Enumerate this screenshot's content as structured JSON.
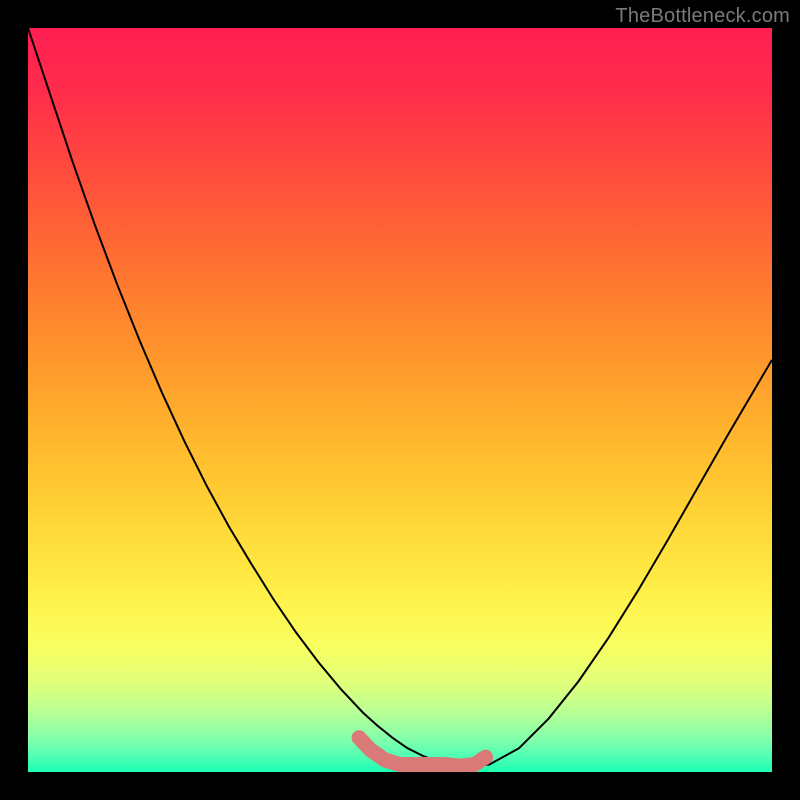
{
  "watermark": "TheBottleneck.com",
  "chart_data": {
    "type": "line",
    "title": "",
    "xlabel": "",
    "ylabel": "",
    "xlim": [
      0,
      1
    ],
    "ylim": [
      0,
      1
    ],
    "grid": false,
    "background_gradient_stops": [
      {
        "pos": 0.0,
        "color": "#ff1f52"
      },
      {
        "pos": 0.085,
        "color": "#ff2c4b"
      },
      {
        "pos": 0.17,
        "color": "#ff4540"
      },
      {
        "pos": 0.255,
        "color": "#ff5e37"
      },
      {
        "pos": 0.34,
        "color": "#ff7830"
      },
      {
        "pos": 0.425,
        "color": "#ff912c"
      },
      {
        "pos": 0.51,
        "color": "#ffaa2c"
      },
      {
        "pos": 0.595,
        "color": "#ffc330"
      },
      {
        "pos": 0.68,
        "color": "#ffdb3a"
      },
      {
        "pos": 0.765,
        "color": "#fff14a"
      },
      {
        "pos": 0.83,
        "color": "#f9ff60"
      },
      {
        "pos": 0.88,
        "color": "#e0ff7a"
      },
      {
        "pos": 0.92,
        "color": "#b8ff94"
      },
      {
        "pos": 0.955,
        "color": "#84ffaa"
      },
      {
        "pos": 0.98,
        "color": "#4effb4"
      },
      {
        "pos": 1.0,
        "color": "#1cffb2"
      }
    ],
    "series": [
      {
        "name": "main-curve",
        "color": "#000000",
        "width": 2,
        "x": [
          0.0,
          0.03,
          0.06,
          0.09,
          0.12,
          0.15,
          0.18,
          0.21,
          0.24,
          0.27,
          0.3,
          0.33,
          0.36,
          0.39,
          0.42,
          0.45,
          0.47,
          0.49,
          0.51,
          0.53,
          0.55,
          0.57,
          0.59,
          0.62,
          0.66,
          0.7,
          0.74,
          0.78,
          0.82,
          0.86,
          0.9,
          0.94,
          0.98,
          1.0
        ],
        "y": [
          1.0,
          0.91,
          0.82,
          0.735,
          0.655,
          0.58,
          0.51,
          0.445,
          0.385,
          0.33,
          0.28,
          0.232,
          0.188,
          0.148,
          0.112,
          0.08,
          0.062,
          0.046,
          0.032,
          0.022,
          0.014,
          0.009,
          0.006,
          0.01,
          0.032,
          0.072,
          0.122,
          0.18,
          0.244,
          0.312,
          0.382,
          0.452,
          0.52,
          0.554
        ]
      },
      {
        "name": "highlight-band",
        "color": "#d97a78",
        "width": 15,
        "x": [
          0.445,
          0.46,
          0.48,
          0.5,
          0.52,
          0.54,
          0.56,
          0.58,
          0.6,
          0.615
        ],
        "y": [
          0.046,
          0.03,
          0.016,
          0.01,
          0.01,
          0.01,
          0.01,
          0.008,
          0.01,
          0.02
        ]
      }
    ]
  }
}
